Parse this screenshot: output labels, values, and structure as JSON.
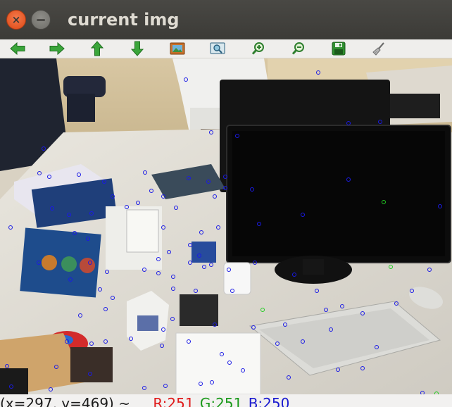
{
  "window": {
    "title": "current img",
    "close_glyph": "×",
    "minimize_glyph": "−"
  },
  "toolbar": {
    "buttons": [
      {
        "name": "pan-left-button",
        "icon": "arrow-left-icon",
        "color": "#3aa53a"
      },
      {
        "name": "pan-right-button",
        "icon": "arrow-right-icon",
        "color": "#3aa53a"
      },
      {
        "name": "pan-up-button",
        "icon": "arrow-up-icon",
        "color": "#3aa53a"
      },
      {
        "name": "pan-down-button",
        "icon": "arrow-down-icon",
        "color": "#3aa53a"
      },
      {
        "name": "zoom-fit-button",
        "icon": "image-icon",
        "color": "#c8702a"
      },
      {
        "name": "zoom-original-button",
        "icon": "zoom-image-icon",
        "color": "#2a7f9e"
      },
      {
        "name": "zoom-in-button",
        "icon": "zoom-in-icon",
        "color": "#3aa53a"
      },
      {
        "name": "zoom-out-button",
        "icon": "zoom-out-icon",
        "color": "#3aa53a"
      },
      {
        "name": "save-button",
        "icon": "save-icon",
        "color": "#2f8f2f"
      },
      {
        "name": "properties-button",
        "icon": "brush-icon",
        "color": "#8a8a8a"
      }
    ]
  },
  "status": {
    "coords": "(x=297, y=469) ~",
    "r": "R:251",
    "g": "G:251",
    "b": "B:250"
  },
  "colors": {
    "titlebar": "#3c3b37",
    "keypoint": "#1a1ae6",
    "keypoint_alt": "#22cc22"
  }
}
